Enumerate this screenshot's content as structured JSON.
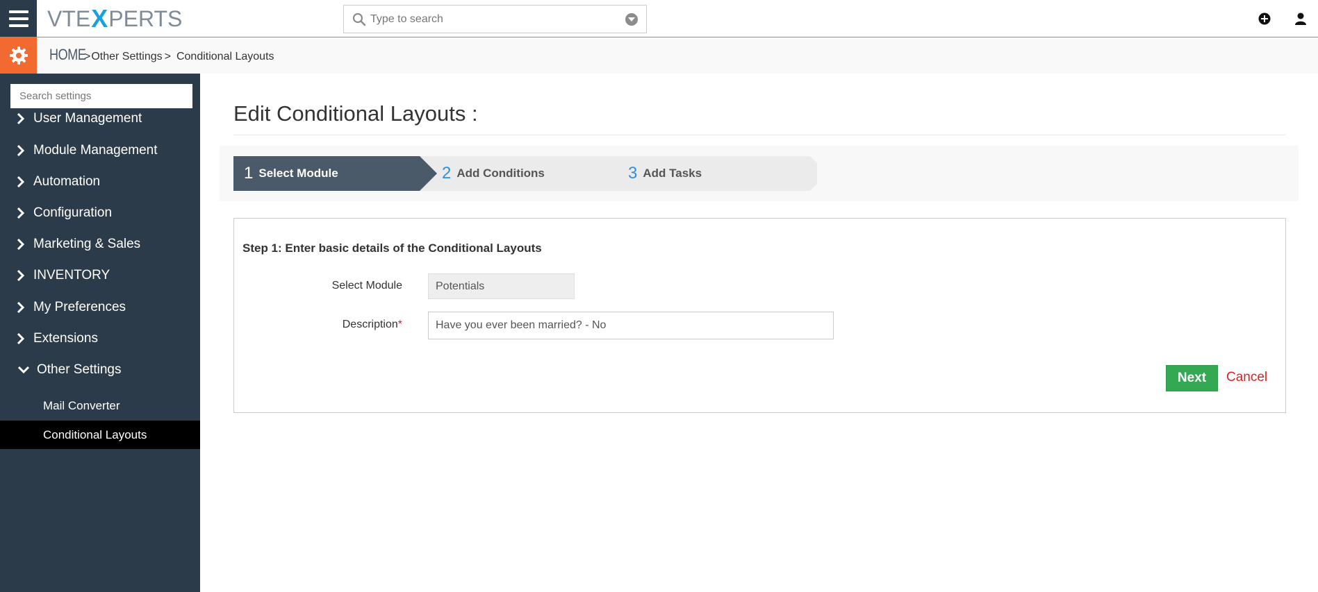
{
  "header": {
    "logo_left": "VTE",
    "logo_x": "X",
    "logo_right": "PERTS",
    "search_placeholder": "Type to search"
  },
  "breadcrumb": {
    "home": "HOME",
    "sep1": ">",
    "item1": "Other Settings",
    "sep2": ">",
    "item2": "Conditional Layouts"
  },
  "sidebar": {
    "search_placeholder": "Search settings",
    "items": [
      {
        "label": "User Management"
      },
      {
        "label": "Module Management"
      },
      {
        "label": "Automation"
      },
      {
        "label": "Configuration"
      },
      {
        "label": "Marketing & Sales"
      },
      {
        "label": "INVENTORY"
      },
      {
        "label": "My Preferences"
      },
      {
        "label": "Extensions"
      },
      {
        "label": "Other Settings"
      }
    ],
    "subitems": [
      {
        "label": "Mail Converter"
      },
      {
        "label": "Conditional Layouts",
        "active": true
      }
    ]
  },
  "main": {
    "title": "Edit Conditional Layouts :",
    "steps": [
      {
        "num": "1",
        "label": "Select Module",
        "active": true
      },
      {
        "num": "2",
        "label": "Add Conditions",
        "active": false
      },
      {
        "num": "3",
        "label": "Add Tasks",
        "active": false
      }
    ],
    "form": {
      "heading": "Step 1: Enter basic details of the Conditional Layouts",
      "module_label": "Select Module",
      "module_value": "Potentials",
      "description_label": "Description",
      "required_mark": "*",
      "description_value": "Have you ever been married? - No",
      "next_label": "Next",
      "cancel_label": "Cancel"
    }
  },
  "colors": {
    "sidebar_bg": "#2c3b49",
    "accent_orange": "#f26a30",
    "active_step_bg": "#4b5a68",
    "step_number_blue": "#2f8fe0",
    "next_green": "#34a853",
    "cancel_red": "#e02020"
  }
}
